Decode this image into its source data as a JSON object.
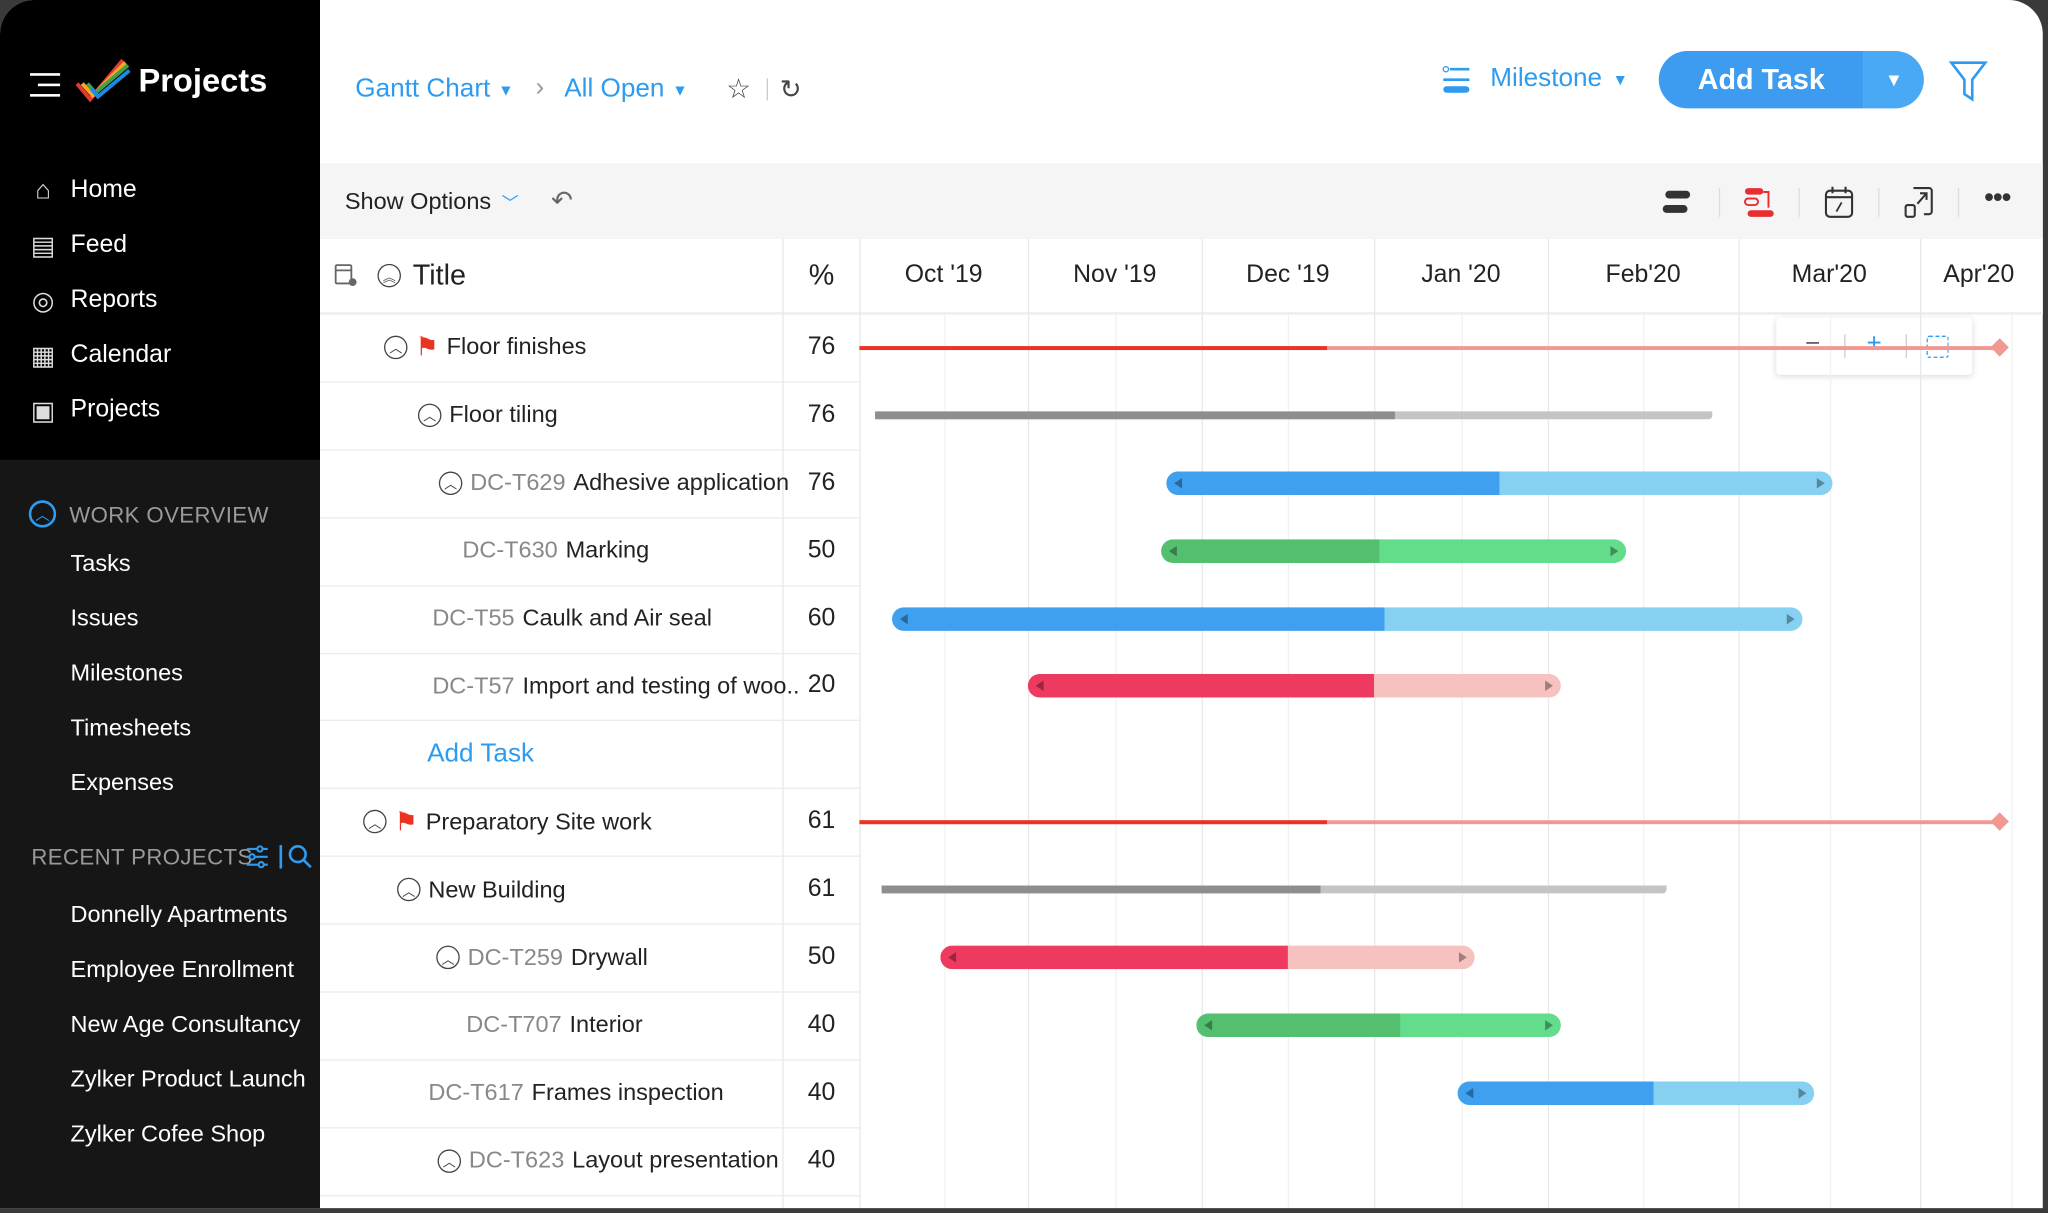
{
  "app": {
    "title": "Projects"
  },
  "sidebar": {
    "nav": [
      {
        "label": "Home",
        "icon": "home-icon"
      },
      {
        "label": "Feed",
        "icon": "feed-icon"
      },
      {
        "label": "Reports",
        "icon": "reports-icon"
      },
      {
        "label": "Calendar",
        "icon": "calendar-icon"
      },
      {
        "label": "Projects",
        "icon": "briefcase-icon"
      }
    ],
    "work_overview": {
      "label": "WORK OVERVIEW",
      "items": [
        "Tasks",
        "Issues",
        "Milestones",
        "Timesheets",
        "Expenses"
      ]
    },
    "recent_projects": {
      "label": "RECENT PROJECTS",
      "items": [
        "Donnelly Apartments",
        "Employee Enrollment",
        "New Age Consultancy",
        "Zylker Product Launch",
        "Zylker Cofee Shop"
      ]
    }
  },
  "header": {
    "view": "Gantt Chart",
    "filter": "All Open",
    "group_by": "Milestone",
    "add_task": "Add Task"
  },
  "toolbar": {
    "show_options": "Show Options"
  },
  "columns": {
    "title": "Title",
    "percent": "%"
  },
  "colors": {
    "accent": "#2d9cf0",
    "red": "#ee3a5f",
    "red_light": "#f6c2c0",
    "blue": "#3fa0ef",
    "blue_light": "#86d0f2",
    "green": "#55bf70",
    "green_light": "#63dc8b",
    "milestone": "#ea3323",
    "milestone_light": "#f29892",
    "summary": "#8e8e8e",
    "summary_light": "#c4c4c4"
  },
  "chart_data": {
    "type": "gantt",
    "months": [
      "Oct '19",
      "Nov '19",
      "Dec '19",
      "Jan '20",
      "Feb'20",
      "Mar'20",
      "Apr'20"
    ],
    "rows": [
      {
        "id": "",
        "title": "Floor finishes",
        "percent": "76",
        "kind": "milestone",
        "start": "2019-10-01",
        "end": "2020-04-14",
        "fill": 0.41
      },
      {
        "id": "",
        "title": "Floor tiling",
        "percent": "76",
        "kind": "summary",
        "start": "2019-10-04",
        "end": "2020-02-26",
        "fill": 0.62
      },
      {
        "id": "DC-T629",
        "title": "Adhesive application",
        "percent": "76",
        "kind": "task",
        "color": "blue",
        "start": "2019-11-25",
        "end": "2020-03-17",
        "fill": 0.5
      },
      {
        "id": "DC-T630",
        "title": "Marking",
        "percent": "50",
        "kind": "task",
        "color": "green",
        "start": "2019-11-24",
        "end": "2020-02-13",
        "fill": 0.47
      },
      {
        "id": "DC-T55",
        "title": "Caulk and Air seal",
        "percent": "60",
        "kind": "task",
        "color": "blue",
        "start": "2019-10-07",
        "end": "2020-03-12",
        "fill": 0.54
      },
      {
        "id": "DC-T57",
        "title": "Import and testing of woo..",
        "percent": "20",
        "kind": "task",
        "color": "red",
        "start": "2019-11-01",
        "end": "2020-02-03",
        "fill": 0.65
      },
      {
        "id": "",
        "title": "Add Task",
        "percent": "",
        "kind": "add"
      },
      {
        "id": "",
        "title": "Preparatory Site work",
        "percent": "61",
        "kind": "milestone",
        "start": "2019-10-01",
        "end": "2020-04-14",
        "fill": 0.41
      },
      {
        "id": "",
        "title": "New Building",
        "percent": "61",
        "kind": "summary",
        "start": "2019-10-05",
        "end": "2020-02-19",
        "fill": 0.56
      },
      {
        "id": "DC-T259",
        "title": "Drywall",
        "percent": "50",
        "kind": "task",
        "color": "red",
        "start": "2019-10-16",
        "end": "2020-01-19",
        "fill": 0.65
      },
      {
        "id": "DC-T707",
        "title": "Interior",
        "percent": "40",
        "kind": "task",
        "color": "green",
        "start": "2019-11-30",
        "end": "2020-02-03",
        "fill": 0.56
      },
      {
        "id": "DC-T617",
        "title": "Frames inspection",
        "percent": "40",
        "kind": "task",
        "color": "blue",
        "start": "2020-01-16",
        "end": "2020-03-14",
        "fill": 0.55
      },
      {
        "id": "DC-T623",
        "title": "Layout presentation",
        "percent": "40",
        "kind": "task-none"
      }
    ]
  }
}
